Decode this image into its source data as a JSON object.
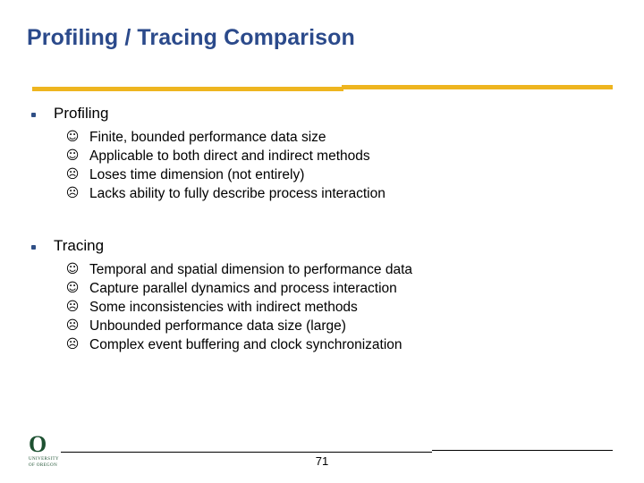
{
  "slide": {
    "title": "Profiling / Tracing Comparison",
    "page_number": "71",
    "accent_gold": "#eeb51f",
    "title_blue": "#2b4a8b",
    "bullet_blue": "#2f4f86",
    "logo_green": "#1d5131"
  },
  "logo": {
    "mark": "O",
    "line1": "UNIVERSITY",
    "line2": "OF OREGON"
  },
  "sections": [
    {
      "heading": "Profiling",
      "items": [
        {
          "face": "smile",
          "glyph": "☺",
          "text": "Finite, bounded performance data size"
        },
        {
          "face": "smile",
          "glyph": "☺",
          "text": "Applicable to both direct and indirect methods"
        },
        {
          "face": "neutral",
          "glyph": "☹",
          "text": "Loses time dimension (not entirely)"
        },
        {
          "face": "frown",
          "glyph": "☹",
          "text": "Lacks ability to fully describe process interaction"
        }
      ]
    },
    {
      "heading": "Tracing",
      "items": [
        {
          "face": "smile",
          "glyph": "☺",
          "text": "Temporal and spatial dimension to performance data"
        },
        {
          "face": "smile",
          "glyph": "☺",
          "text": "Capture parallel dynamics and process interaction"
        },
        {
          "face": "neutral",
          "glyph": "☹",
          "text": "Some inconsistencies with indirect methods"
        },
        {
          "face": "frown",
          "glyph": "☹",
          "text": "Unbounded performance data size (large)"
        },
        {
          "face": "frown",
          "glyph": "☹",
          "text": "Complex event buffering and clock synchronization"
        }
      ]
    }
  ]
}
